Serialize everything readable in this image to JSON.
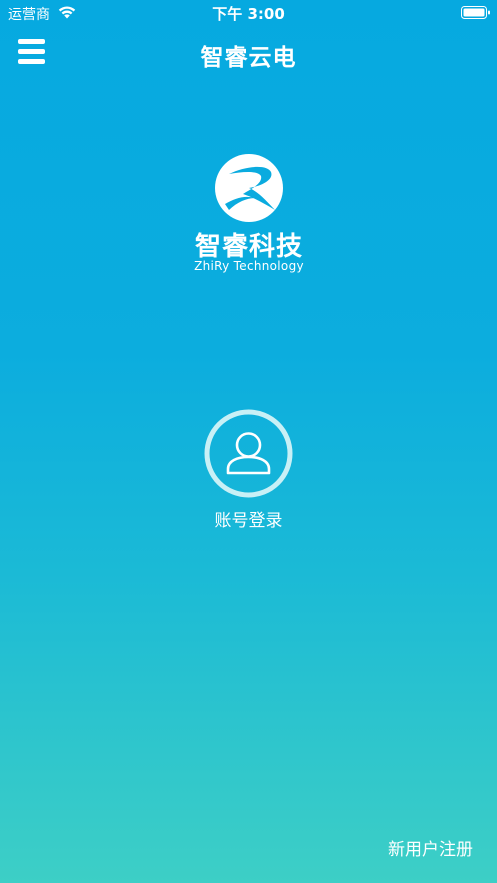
{
  "status_bar": {
    "carrier": "运营商",
    "time": "下午 3:00",
    "wifi_icon": "wifi-icon",
    "battery_icon": "battery-icon"
  },
  "nav": {
    "title": "智睿云电",
    "menu_icon": "hamburger-menu-icon"
  },
  "logo": {
    "mark_letter": "R",
    "name_cn": "智睿科技",
    "name_en": "ZhiRy Technology"
  },
  "login": {
    "icon": "user-icon",
    "label": "账号登录"
  },
  "register": {
    "label": "新用户注册"
  },
  "colors": {
    "gradient_top": "#06a9e0",
    "gradient_bottom": "#3dcfc6",
    "text": "#ffffff",
    "ring": "#c8f0f6"
  }
}
